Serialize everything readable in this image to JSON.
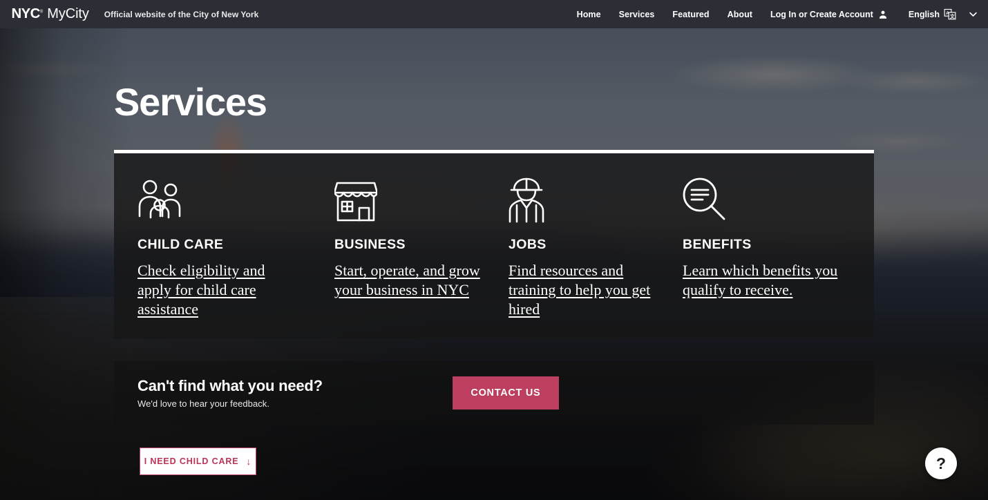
{
  "topbar": {
    "logo_mark": "NYC",
    "logo_tm": "®",
    "brand_name": "MyCity",
    "official_text": "Official website of the City of New York",
    "nav_links": [
      {
        "label": "Home"
      },
      {
        "label": "Services"
      },
      {
        "label": "Featured"
      },
      {
        "label": "About"
      }
    ],
    "account_label": "Log In or Create Account",
    "account_icon": "person-icon",
    "language_label": "English",
    "language_icon": "translate-icon",
    "chevron_icon": "chevron-down-icon"
  },
  "hero": {
    "title": "Services"
  },
  "services": [
    {
      "icon": "family-icon",
      "title": "CHILD CARE",
      "description": "Check eligibility and apply for child care assistance"
    },
    {
      "icon": "storefront-icon",
      "title": "BUSINESS",
      "description": "Start, operate, and grow your business in NYC"
    },
    {
      "icon": "hardhat-worker-icon",
      "title": "JOBS",
      "description": "Find resources and training to help you get hired"
    },
    {
      "icon": "magnifier-list-icon",
      "title": "BENEFITS",
      "description": "Learn which benefits you qualify to receive."
    }
  ],
  "contact": {
    "heading": "Can't find what you need?",
    "subtext": "We'd love to hear your feedback.",
    "button_label": "CONTACT US"
  },
  "cta": {
    "label": "I NEED CHILD CARE",
    "arrow": "↓"
  },
  "help": {
    "label": "?"
  },
  "colors": {
    "topbar_bg": "#2b2e35",
    "accent_crimson": "#bd3f5f",
    "cta_border": "#c2496a",
    "cta_text": "#bb3355",
    "panel_bg": "rgba(22,22,22,0.80)",
    "panel_border_top": "#ffffff",
    "text_on_dark": "#ffffff"
  }
}
